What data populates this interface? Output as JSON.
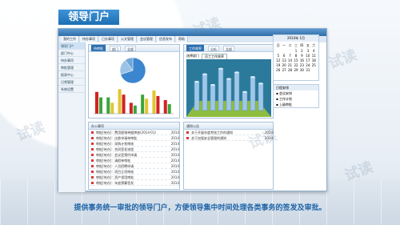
{
  "app": {
    "banner_title": "领导门户",
    "caption": "提供事务统一审批的领导门户，方便领导集中时间处理各类事务的签发及审批。"
  },
  "tabs": [
    "我的工作",
    "待办事项",
    "已办事项",
    "公文管理",
    "会议管理",
    "信息发布",
    "帮助"
  ],
  "sidebar": {
    "items": [
      "领导门户",
      "部门中心",
      "待办事项",
      "审批管理",
      "报表中心",
      "日常管理",
      "系统设置"
    ]
  },
  "panels": {
    "left_chart": {
      "header_left": "待审批",
      "header_mid": "部门",
      "header_right": "全部"
    },
    "work_status": {
      "title": "工作效率",
      "header_mid": "分析",
      "header_right": "全部",
      "filter_label": "选择部门",
      "filter_value": "员工工作效率"
    },
    "todo": {
      "title": "办公事项",
      "rows": [
        {
          "text": "审批[待办]：费用报销单据审核(2014-01)",
          "date": "2014"
        },
        {
          "text": "审批[待办]：出差申请单审批",
          "date": "2014"
        },
        {
          "text": "审批[待办]：采购计划审核",
          "date": "2014"
        },
        {
          "text": "审批[待办]：合同签发流程",
          "date": "2014"
        },
        {
          "text": "审批[待办]：会议室预约申请",
          "date": "2014"
        },
        {
          "text": "审批[待办]：请假单审批",
          "date": "2014"
        },
        {
          "text": "审批[待办]：人员招聘申请",
          "date": "2014"
        },
        {
          "text": "审批[待办]：项目立项审核",
          "date": "2014"
        },
        {
          "text": "审批[待办]：资产领用审批",
          "date": "2014"
        },
        {
          "text": "审批[待办]：年度预算签发",
          "date": "2014"
        }
      ]
    },
    "notice": {
      "title": "通知公告",
      "rows": [
        {
          "text": "关于开展年度考核工作的通知",
          "date": "2014"
        },
        {
          "text": "关于加强安全管理的通知",
          "date": "2014"
        }
      ]
    }
  },
  "calendar": {
    "title": "2014年 1月",
    "weekdays": [
      "日",
      "一",
      "二",
      "三",
      "四",
      "五",
      "六"
    ],
    "days": [
      "",
      "",
      "",
      "1",
      "2",
      "3",
      "4",
      "5",
      "6",
      "7",
      "8",
      "9",
      "10",
      "11",
      "12",
      "13",
      "14",
      "15",
      "16",
      "17",
      "18",
      "19",
      "20",
      "21",
      "22",
      "23",
      "24",
      "25",
      "26",
      "27",
      "28",
      "29",
      "30",
      "31"
    ],
    "events_title": "日程安排",
    "events": [
      "会议安排",
      "工作计划",
      "上级审批"
    ]
  },
  "watermarks": [
    "试读",
    "试读",
    "试读",
    "试读",
    "试读"
  ],
  "colors": {
    "accent": "#1d6fb4",
    "red": "#d22222",
    "green": "#3aa53a",
    "yellow": "#e2c530"
  },
  "chart_data": [
    {
      "type": "pie",
      "values": [
        70,
        20,
        10
      ],
      "labels": [
        "",
        "",
        ""
      ]
    },
    {
      "type": "bar",
      "categories": [
        "1",
        "2",
        "3",
        "4",
        "5",
        "6",
        "7"
      ],
      "series": [
        {
          "values": [
            80,
            60,
            90,
            40,
            70,
            85,
            50
          ]
        },
        {
          "values": [
            60,
            40,
            70,
            30,
            55,
            65,
            35
          ]
        }
      ],
      "ylim": [
        0,
        100
      ]
    },
    {
      "type": "bar",
      "categories": [
        "1",
        "2",
        "3",
        "4",
        "5",
        "6",
        "7",
        "8",
        "9"
      ],
      "values": [
        62,
        78,
        55,
        90,
        68,
        82,
        40,
        72,
        58
      ],
      "ylim": [
        0,
        100
      ]
    }
  ]
}
